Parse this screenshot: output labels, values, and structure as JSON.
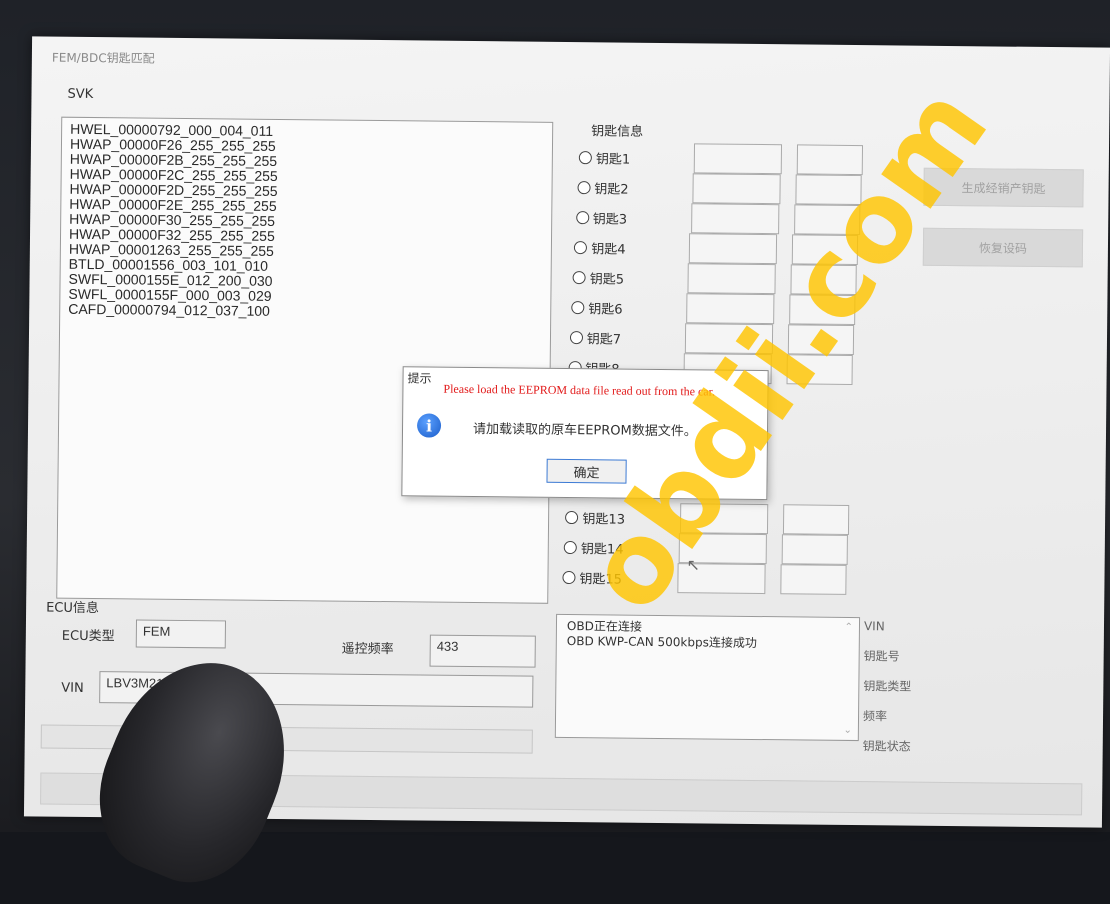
{
  "window": {
    "title": "FEM/BDC钥匙匹配"
  },
  "svk": {
    "label": "SVK",
    "items": [
      "HWEL_00000792_000_004_011",
      "HWAP_00000F26_255_255_255",
      "HWAP_00000F2B_255_255_255",
      "HWAP_00000F2C_255_255_255",
      "HWAP_00000F2D_255_255_255",
      "HWAP_00000F2E_255_255_255",
      "HWAP_00000F30_255_255_255",
      "HWAP_00000F32_255_255_255",
      "HWAP_00001263_255_255_255",
      "BTLD_00001556_003_101_010",
      "SWFL_0000155E_012_200_030",
      "SWFL_0000155F_000_003_029",
      "CAFD_00000794_012_037_100"
    ]
  },
  "keys": {
    "label": "钥匙信息",
    "items": [
      "钥匙1",
      "钥匙2",
      "钥匙3",
      "钥匙4",
      "钥匙5",
      "钥匙6",
      "钥匙7",
      "钥匙8",
      "钥匙13",
      "钥匙14",
      "钥匙15"
    ]
  },
  "buttons": {
    "generate": "生成经销产钥匙",
    "restore": "恢复设码"
  },
  "ecu": {
    "section_label": "ECU信息",
    "type_label": "ECU类型",
    "type_value": "FEM",
    "freq_label": "遥控频率",
    "freq_value": "433",
    "vin_label": "VIN",
    "vin_value": "LBV3M2101FM"
  },
  "status": {
    "lines": [
      "OBD正在连接",
      "OBD KWP-CAN 500kbps连接成功"
    ]
  },
  "side_info": {
    "vin": "VIN",
    "key_no": "钥匙号",
    "key_type": "钥匙类型",
    "freq": "频率",
    "key_state": "钥匙状态"
  },
  "dialog": {
    "title": "提示",
    "english": "Please load the EEPROM data file read out from the car.",
    "chinese": "请加载读取的原车EEPROM数据文件。",
    "ok_label": "确定"
  },
  "watermark": "obdii.com"
}
